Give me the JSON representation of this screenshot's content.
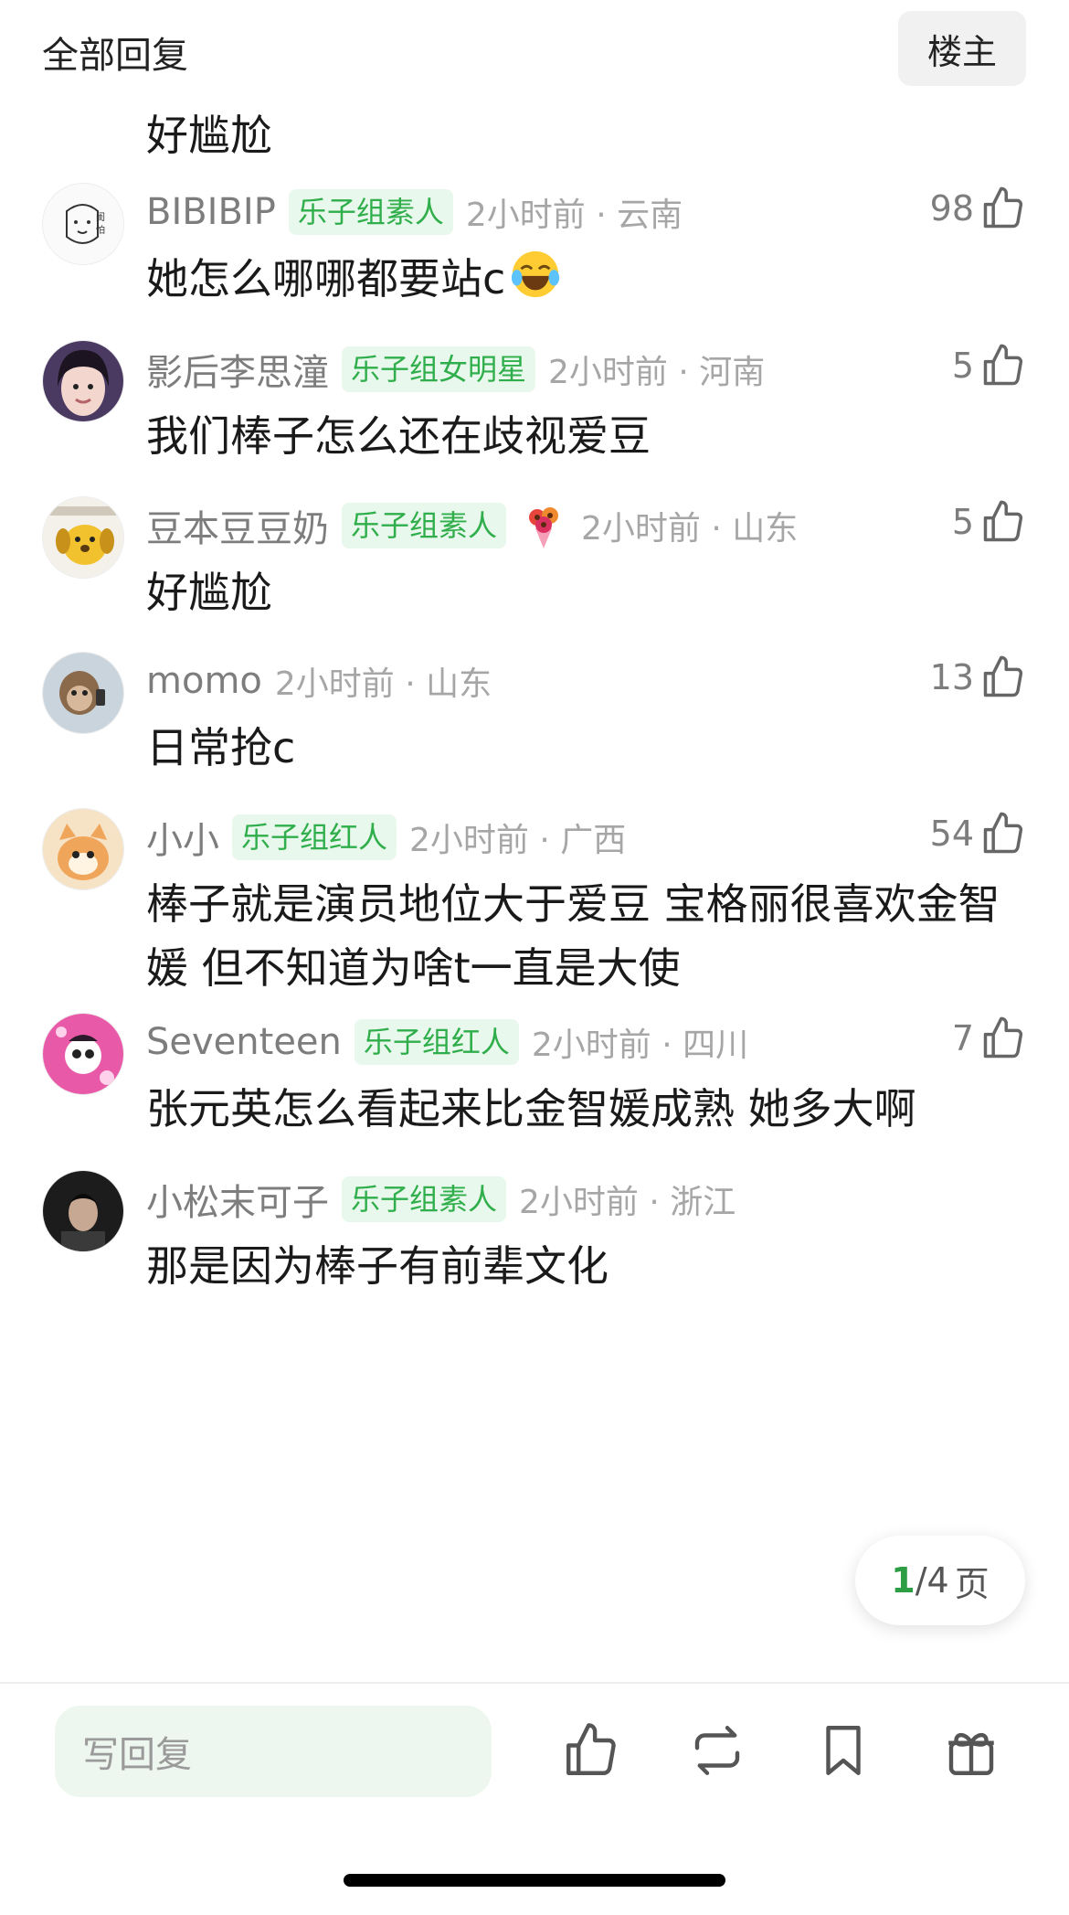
{
  "header": {
    "title": "全部回复",
    "owner_button": "楼主"
  },
  "top_reply_text": "好尴尬",
  "comments": [
    {
      "user": "BIBIBIP",
      "badge": "乐子组素人",
      "time": "2小时前 · 云南",
      "likes": "98",
      "text": "她怎么哪哪都要站c",
      "emoji": "laughing-tears-emoji",
      "avatar": "sketch-avatar"
    },
    {
      "user": "影后李思潼",
      "badge": "乐子组女明星",
      "time": "2小时前 · 河南",
      "likes": "5",
      "text": "我们棒子怎么还在歧视爱豆",
      "avatar": "girl-photo-avatar"
    },
    {
      "user": "豆本豆豆奶",
      "badge": "乐子组素人",
      "time": "2小时前 · 山东",
      "likes": "5",
      "text": "好尴尬",
      "avatar": "yellow-dog-avatar",
      "sticker": "flower-bouquet-sticker"
    },
    {
      "user": "momo",
      "badge": "",
      "time": "2小时前 · 山东",
      "likes": "13",
      "text": "日常抢c",
      "avatar": "monkey-avatar"
    },
    {
      "user": "小小",
      "badge": "乐子组红人",
      "time": "2小时前 · 广西",
      "likes": "54",
      "text": "棒子就是演员地位大于爱豆 宝格丽很喜欢金智媛 但不知道为啥t一直是大使",
      "avatar": "cat-avatar"
    },
    {
      "user": "Seventeen",
      "badge": "乐子组红人",
      "time": "2小时前 · 四川",
      "likes": "7",
      "text": "张元英怎么看起来比金智媛成熟 她多大啊",
      "avatar": "pink-character-avatar"
    },
    {
      "user": "小松末可子",
      "badge": "乐子组素人",
      "time": "2小时前 · 浙江",
      "likes": "",
      "text": "那是因为棒子有前辈文化",
      "avatar": "portrait-avatar"
    }
  ],
  "pager": {
    "current": "1",
    "total": "/4",
    "unit": "页"
  },
  "bottom_bar": {
    "reply_placeholder": "写回复"
  },
  "colors": {
    "accent_green": "#2fae4b",
    "badge_bg": "#e9f8ec",
    "meta_gray": "#a6a6a6"
  }
}
